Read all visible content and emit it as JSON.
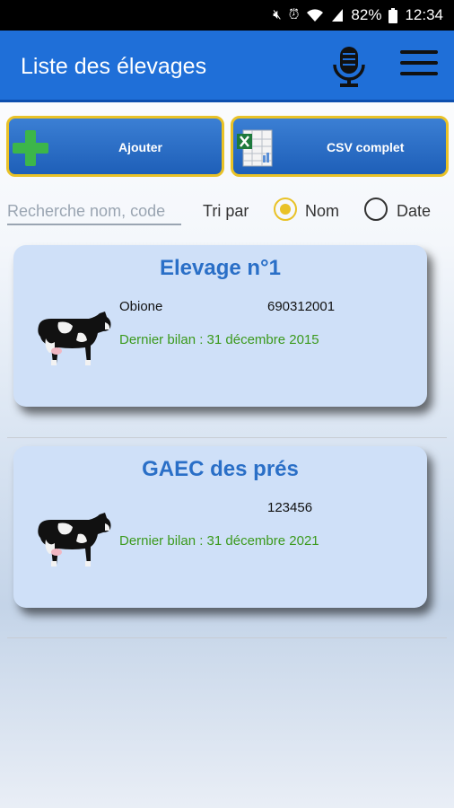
{
  "status": {
    "battery": "82%",
    "time": "12:34"
  },
  "appbar": {
    "title": "Liste des élevages"
  },
  "toolbar": {
    "add_label": "Ajouter",
    "csv_label": "CSV complet"
  },
  "search": {
    "placeholder": "Recherche nom, code",
    "value": ""
  },
  "sort": {
    "label": "Tri par",
    "options": [
      "Nom",
      "Date"
    ],
    "selected": "Nom"
  },
  "farms": [
    {
      "title": "Elevage n°1",
      "owner": "Obione",
      "code": "690312001",
      "last_report": "Dernier bilan : 31 décembre 2015"
    },
    {
      "title": "GAEC des prés",
      "owner": "",
      "code": "123456",
      "last_report": "Dernier bilan : 31 décembre 2021"
    }
  ],
  "colors": {
    "appbar": "#1f6fd8",
    "accent": "#e9c227",
    "card": "#cfe0f8",
    "title": "#2a6fc7",
    "report": "#3c9a1e"
  }
}
